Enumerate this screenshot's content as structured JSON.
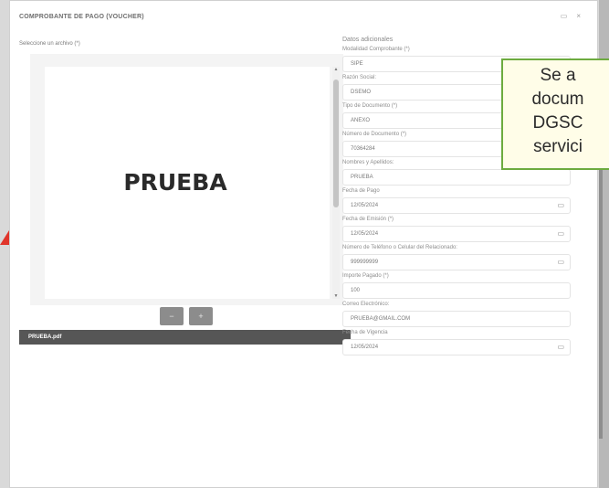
{
  "modal": {
    "title": "COMPROBANTE DE PAGO (VOUCHER)",
    "controls": [
      "▭",
      "×"
    ],
    "file_label": "Seleccione un archivo (*)",
    "document_text": "PRUEBA",
    "page_buttons": [
      "−",
      "+"
    ],
    "filename": "PRUEBA.pdf"
  },
  "form": {
    "heading": "Datos adicionales",
    "fields": [
      {
        "label": "Modalidad Comprobante (*)",
        "value": "SIPE"
      },
      {
        "label": "Razón Social:",
        "value": "DSEMO"
      },
      {
        "label": "Tipo de Documento (*)",
        "value": "ANEXO"
      },
      {
        "label": "Número de Documento (*)",
        "value": "70364284"
      },
      {
        "label": "Nombres y Apellidos:",
        "value": "PRUEBA"
      },
      {
        "label": "Fecha de Pago",
        "value": "12/05/2024",
        "calendar": true
      },
      {
        "label": "Fecha de Emisión (*)",
        "value": "12/05/2024",
        "calendar": true
      },
      {
        "label": "Número de Teléfono o Celular del Relacionado:",
        "value": "999999999",
        "calendar": true
      },
      {
        "label": "Importe Pagado (*)",
        "value": "100"
      },
      {
        "label": "Correo Electrónico:",
        "value": "PRUEBA@GMAIL.COM"
      },
      {
        "label": "Fecha de Vigencia",
        "value": "12/05/2024",
        "calendar": true
      }
    ]
  },
  "callout": {
    "lines": [
      "Se a",
      "docum",
      "DGSC",
      "servici"
    ]
  },
  "colors": {
    "accent_arrow": "#e0352b",
    "callout_border": "#6dab3f",
    "filebar": "#565656"
  }
}
